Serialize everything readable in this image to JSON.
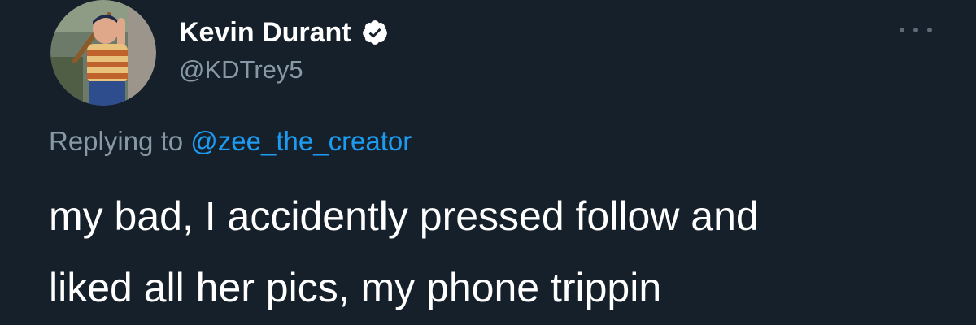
{
  "author": {
    "display_name": "Kevin Durant",
    "handle": "@KDTrey5",
    "verified": true,
    "avatar_icon": "profile-photo-avatar"
  },
  "reply_context": {
    "prefix": "Replying to",
    "mention": "@zee_the_creator"
  },
  "tweet": {
    "lines": [
      "my bad, I accidently pressed follow and",
      "liked all her pics, my phone trippin"
    ]
  },
  "menu": {
    "icon": "more-options-icon"
  },
  "colors": {
    "background": "#15202b",
    "text_primary": "#ffffff",
    "text_secondary": "#8899a6",
    "link": "#1d9bf0"
  }
}
